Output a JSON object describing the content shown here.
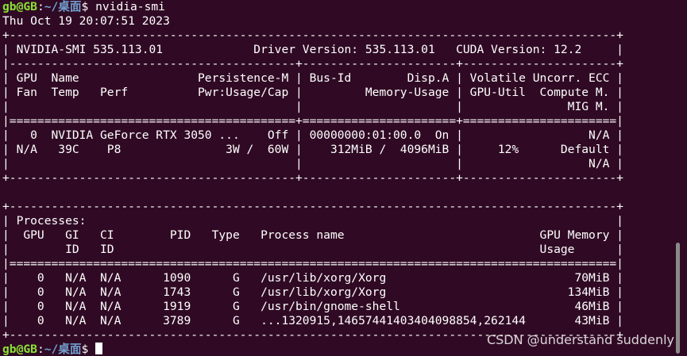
{
  "prompt": {
    "user": "gb@GB",
    "sep": ":",
    "path": "~/桌面",
    "symbol": "$"
  },
  "command": " nvidia-smi",
  "timestamp": "Thu Oct 19 20:07:51 2023",
  "output_lines": [
    "+---------------------------------------------------------------------------------------+",
    "| NVIDIA-SMI 535.113.01             Driver Version: 535.113.01   CUDA Version: 12.2     |",
    "|-----------------------------------------+----------------------+----------------------+",
    "| GPU  Name                 Persistence-M | Bus-Id        Disp.A | Volatile Uncorr. ECC |",
    "| Fan  Temp   Perf          Pwr:Usage/Cap |         Memory-Usage | GPU-Util  Compute M. |",
    "|                                         |                      |               MIG M. |",
    "|=========================================+======================+======================|",
    "|   0  NVIDIA GeForce RTX 3050 ...    Off | 00000000:01:00.0  On |                  N/A |",
    "| N/A   39C    P8               3W /  60W |    312MiB /  4096MiB |     12%      Default |",
    "|                                         |                      |                  N/A |",
    "+-----------------------------------------+----------------------+----------------------+",
    "",
    "+---------------------------------------------------------------------------------------+",
    "| Processes:                                                                            |",
    "|  GPU   GI   CI        PID   Type   Process name                            GPU Memory |",
    "|        ID   ID                                                             Usage      |",
    "|=======================================================================================|",
    "|    0   N/A  N/A      1090      G   /usr/lib/xorg/Xorg                           70MiB |",
    "|    0   N/A  N/A      1743      G   /usr/lib/xorg/Xorg                          134MiB |",
    "|    0   N/A  N/A      1919      G   /usr/bin/gnome-shell                         46MiB |",
    "|    0   N/A  N/A      3789      G   ...1320915,14657441403404098854,262144       43MiB |",
    "+---------------------------------------------------------------------------------------+"
  ],
  "watermark": "CSDN @understand suddenly",
  "colors": {
    "background": "#300a24",
    "foreground": "#ffffff",
    "prompt_user": "#8ae234",
    "prompt_path": "#729fcf"
  }
}
